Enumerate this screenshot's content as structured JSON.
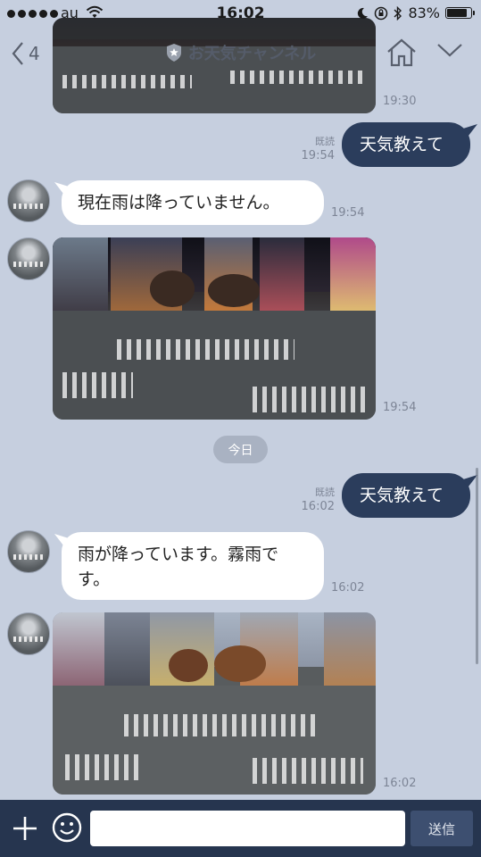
{
  "status_bar": {
    "carrier": "au",
    "time": "16:02",
    "battery_percent": "83%",
    "battery_level": 0.83
  },
  "header": {
    "back_count": "4",
    "title": "お天気チャンネル"
  },
  "messages": {
    "photo_top_time": "19:30",
    "out1_text": "天気教えて",
    "out1_read": "既読",
    "out1_time": "19:54",
    "in1_text": "現在雨は降っていません。",
    "in1_time": "19:54",
    "photo1_time": "19:54",
    "date_separator": "今日",
    "out2_text": "天気教えて",
    "out2_read": "既読",
    "out2_time": "16:02",
    "in2_text": "雨が降っています。霧雨です。",
    "in2_time": "16:02",
    "photo2_time": "16:02"
  },
  "input_bar": {
    "message_value": "",
    "send_label": "送信"
  }
}
